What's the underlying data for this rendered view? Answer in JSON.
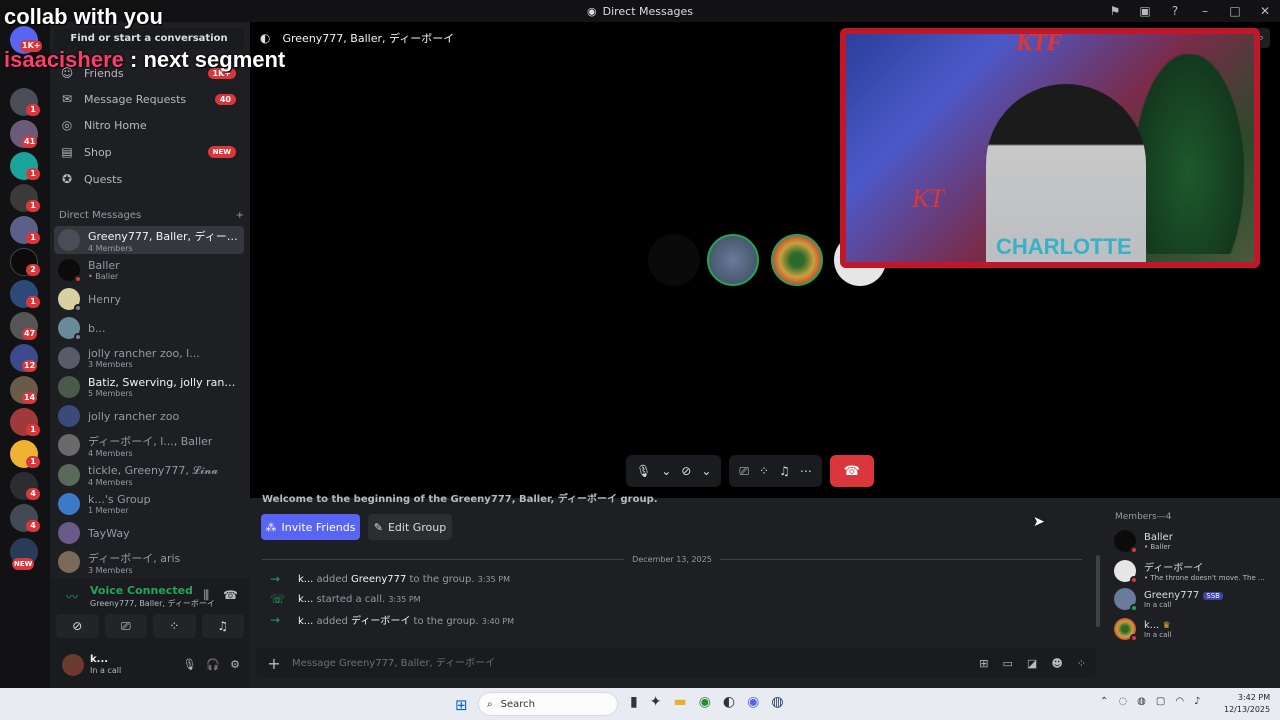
{
  "titlebar": {
    "title": "Direct Messages"
  },
  "stream_overlay": {
    "top_text": "collab with you",
    "chat_user": "isaacishere",
    "chat_message": ": next segment"
  },
  "sidebar": {
    "find_placeholder": "Find or start a conversation",
    "friends_label": "Friends",
    "friends_badge": "1K+",
    "nav": [
      {
        "label": "Message Requests",
        "count": "40"
      },
      {
        "label": "Nitro Home"
      },
      {
        "label": "Shop",
        "badge": "NEW"
      },
      {
        "label": "Quests"
      }
    ],
    "dm_header": "Direct Messages",
    "dms": [
      {
        "name": "Greeny777, Baller, ディーボーイ...",
        "sub": "4 Members"
      },
      {
        "name": "Baller",
        "sub": "• Baller"
      },
      {
        "name": "Henry",
        "sub": ""
      },
      {
        "name": "b...",
        "sub": ""
      },
      {
        "name": "jolly rancher zoo, l...",
        "sub": "3 Members"
      },
      {
        "name": "Batiz, Swerving, jolly rancher ...",
        "sub": "5 Members"
      },
      {
        "name": "jolly rancher zoo",
        "sub": ""
      },
      {
        "name": "ディーボーイ, l..., Baller",
        "sub": "4 Members"
      },
      {
        "name": "tickle, Greeny777, 𝓛𝓲𝓷𝓪",
        "sub": "4 Members"
      },
      {
        "name": "k...'s Group",
        "sub": "1 Member"
      },
      {
        "name": "TayWay",
        "sub": ""
      },
      {
        "name": "ディーボーイ, aris",
        "sub": "3 Members"
      }
    ]
  },
  "rail_badges": [
    "1K+",
    "1",
    "41",
    "1",
    "1",
    "1",
    "2",
    "1",
    "47",
    "12",
    "14",
    "1",
    "1",
    "4",
    "4",
    "NEW"
  ],
  "voice": {
    "status": "Voice Connected",
    "channel": "Greeny777, Baller, ディーボーイ"
  },
  "user": {
    "name": "k...",
    "status": "In a call"
  },
  "call": {
    "header": "Greeny777, Baller, ディーボーイ",
    "search_icon": "⌕"
  },
  "chat": {
    "welcome": "Welcome to the beginning of the Greeny777, Baller, ディーボーイ group.",
    "invite_label": "Invite Friends",
    "edit_label": "Edit Group",
    "date": "December 13, 2025",
    "messages": [
      {
        "actor": "k...",
        "action": "added",
        "target": "Greeny777",
        "tail": "to the group.",
        "time": "3:35 PM"
      },
      {
        "actor": "k...",
        "action": "started a call.",
        "target": "",
        "tail": "",
        "time": "3:35 PM"
      },
      {
        "actor": "k...",
        "action": "added",
        "target": "ディーボーイ",
        "tail": "to the group.",
        "time": "3:40 PM"
      }
    ],
    "placeholder": "Message Greeny777, Baller, ディーボーイ"
  },
  "members": {
    "header": "Members—4",
    "list": [
      {
        "name": "Baller",
        "sub": "• Baller"
      },
      {
        "name": "ディーボーイ",
        "sub": "• The throne doesn't move. The ..."
      },
      {
        "name": "Greeny777",
        "tag": "SSB",
        "sub": "In a call"
      },
      {
        "name": "k...",
        "sub": "In a call"
      }
    ]
  },
  "taskbar": {
    "search": "Search",
    "time": "3:42 PM",
    "date": "12/13/2025"
  },
  "cam": {
    "logo_text": "KTF",
    "shirt_text": "CHARLOTTE",
    "wall_text": "KT"
  }
}
